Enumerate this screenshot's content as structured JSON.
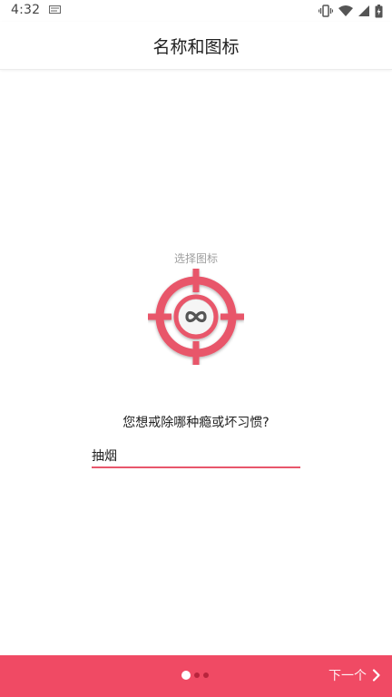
{
  "status_bar": {
    "time": "4:32",
    "icons": [
      "notification-icon",
      "vibrate-icon",
      "wifi-icon",
      "signal-icon",
      "battery-icon"
    ]
  },
  "app_bar": {
    "title": "名称和图标"
  },
  "icon_picker": {
    "caption": "选择图标",
    "icon": "target-infinity-icon",
    "ring_color": "#e8576b"
  },
  "form": {
    "question": "您想戒除哪种瘾或坏习惯?",
    "habit_value": "抽烟"
  },
  "bottom_bar": {
    "background_color": "#f04a64",
    "pager": {
      "current_page": 1,
      "total_pages": 3
    },
    "next_label": "下一个",
    "next_icon": "chevron-right-icon"
  }
}
